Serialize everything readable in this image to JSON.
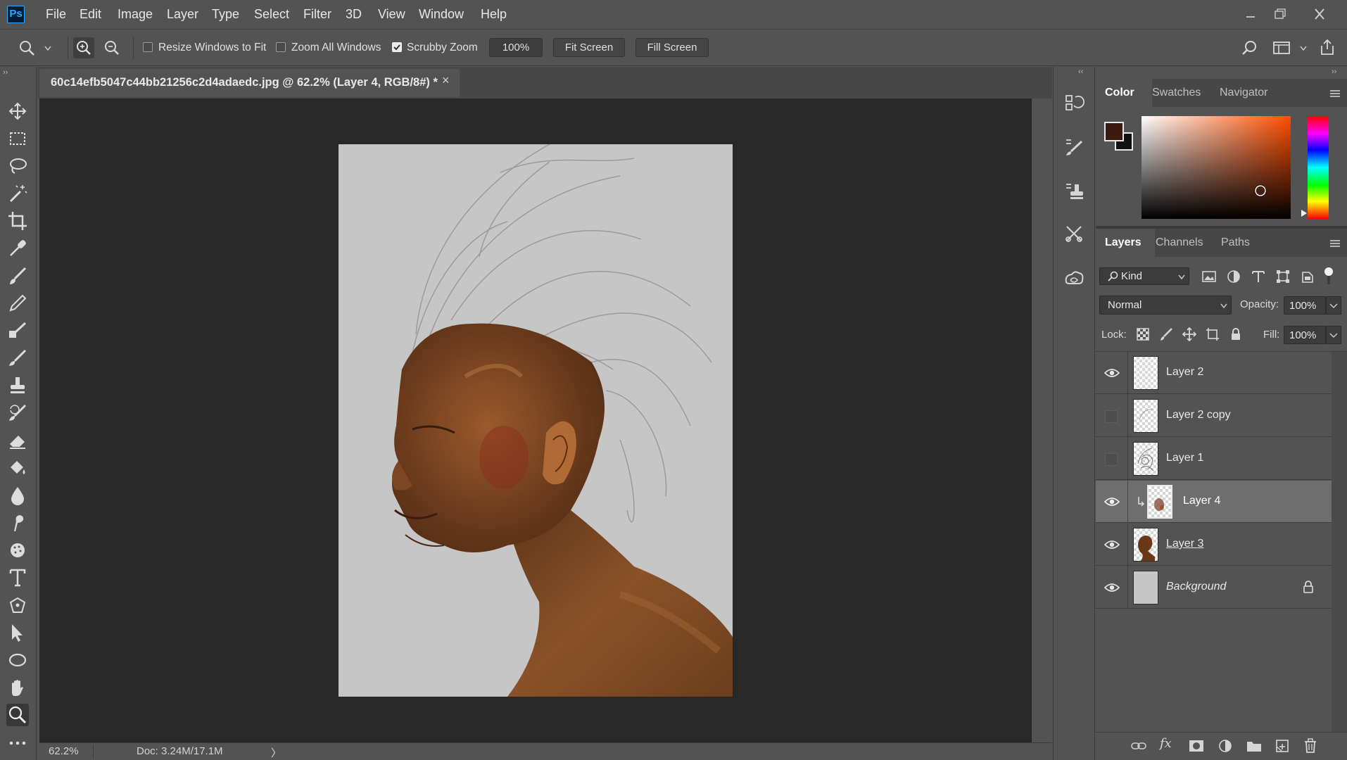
{
  "app": {
    "logo": "Ps"
  },
  "menu": [
    "File",
    "Edit",
    "Image",
    "Layer",
    "Type",
    "Select",
    "Filter",
    "3D",
    "View",
    "Window",
    "Help"
  ],
  "window_controls": [
    "minimize-icon",
    "restore-icon",
    "close-icon"
  ],
  "options_bar": {
    "resize_windows_label": "Resize Windows to Fit",
    "resize_windows_checked": false,
    "zoom_all_label": "Zoom All Windows",
    "zoom_all_checked": false,
    "scrubby_zoom_label": "Scrubby Zoom",
    "scrubby_zoom_checked": true,
    "zoom_value": "100%",
    "fit_screen_label": "Fit Screen",
    "fill_screen_label": "Fill Screen"
  },
  "document": {
    "tab_title": "60c14efb5047c44bb21256c2d4adaedc.jpg @ 62.2% (Layer 4, RGB/8#) *",
    "close_glyph": "×"
  },
  "status_bar": {
    "zoom": "62.2%",
    "doc_info": "Doc: 3.24M/17.1M",
    "arrow": "〉"
  },
  "tools": [
    "move-tool",
    "marquee-tool",
    "lasso-tool",
    "magic-wand-tool",
    "crop-tool",
    "eyedropper-tool",
    "healing-brush-tool",
    "brush-tool",
    "pencil-tool",
    "clone-stamp-tool",
    "history-brush-tool",
    "mixer-brush-tool",
    "eraser-tool",
    "paint-bucket-tool",
    "blur-tool",
    "smudge-tool",
    "sponge-tool",
    "type-tool",
    "pen-tool",
    "path-selection-tool",
    "ellipse-tool",
    "hand-tool",
    "zoom-tool",
    "more-tools"
  ],
  "active_tool": "zoom-tool",
  "color_panel": {
    "tabs": [
      "Color",
      "Swatches",
      "Navigator"
    ],
    "active_tab": "Color",
    "foreground": "#3b1a10",
    "background": "#111111",
    "hue_color": "#ff4d00"
  },
  "layers_panel": {
    "tabs": [
      "Layers",
      "Channels",
      "Paths"
    ],
    "active_tab": "Layers",
    "kind_label": "Kind",
    "blend_mode": "Normal",
    "opacity_label": "Opacity:",
    "opacity_value": "100%",
    "lock_label": "Lock:",
    "fill_label": "Fill:",
    "fill_value": "100%",
    "layers": [
      {
        "name": "Layer 2",
        "visible": true,
        "selected": false,
        "locked": false,
        "italic": false,
        "underline": false,
        "clipped": false
      },
      {
        "name": "Layer 2 copy",
        "visible": false,
        "selected": false,
        "locked": false,
        "italic": false,
        "underline": false,
        "clipped": false
      },
      {
        "name": "Layer 1",
        "visible": false,
        "selected": false,
        "locked": false,
        "italic": false,
        "underline": false,
        "clipped": false
      },
      {
        "name": "Layer 4",
        "visible": true,
        "selected": true,
        "locked": false,
        "italic": false,
        "underline": false,
        "clipped": true
      },
      {
        "name": "Layer 3",
        "visible": true,
        "selected": false,
        "locked": false,
        "italic": false,
        "underline": true,
        "clipped": false
      },
      {
        "name": "Background",
        "visible": true,
        "selected": false,
        "locked": true,
        "italic": true,
        "underline": false,
        "clipped": false
      }
    ]
  }
}
